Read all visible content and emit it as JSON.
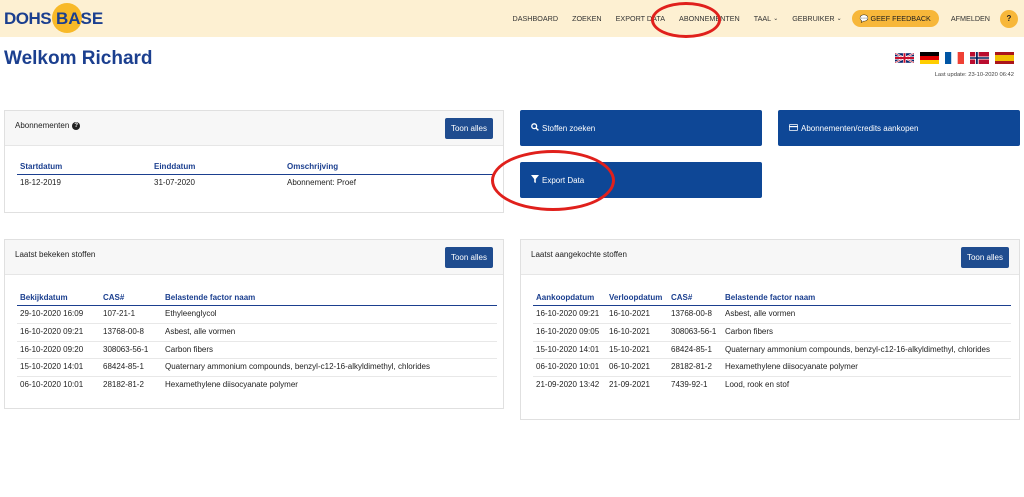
{
  "brand": {
    "part1": "DOHS",
    "part2": "BASE"
  },
  "nav": {
    "dashboard": "DASHBOARD",
    "zoeken": "ZOEKEN",
    "export": "EXPORT DATA",
    "abonnementen": "ABONNEMENTEN",
    "taal": "TAAL",
    "gebruiker": "GEBRUIKER",
    "feedback": "GEEF FEEDBACK",
    "afmelden": "AFMELDEN",
    "help": "?"
  },
  "welcome": "Welkom Richard",
  "last_update": "Last update: 23-10-2020 06:42",
  "subscriptions": {
    "title": "Abonnementen",
    "button": "Toon alles",
    "headers": [
      "Startdatum",
      "Einddatum",
      "Omschrijving"
    ],
    "rows": [
      [
        "18-12-2019",
        "31-07-2020",
        "Abonnement: Proef"
      ]
    ]
  },
  "actions": {
    "search": "Stoffen zoeken",
    "buy": "Abonnementen/credits aankopen",
    "export": "Export Data"
  },
  "viewed": {
    "title": "Laatst bekeken stoffen",
    "button": "Toon alles",
    "headers": [
      "Bekijkdatum",
      "CAS#",
      "Belastende factor naam"
    ],
    "rows": [
      [
        "29-10-2020 16:09",
        "107-21-1",
        "Ethyleenglycol"
      ],
      [
        "16-10-2020 09:21",
        "13768-00-8",
        "Asbest, alle vormen"
      ],
      [
        "16-10-2020 09:20",
        "308063-56-1",
        "Carbon fibers"
      ],
      [
        "15-10-2020 14:01",
        "68424-85-1",
        "Quaternary ammonium compounds, benzyl-c12-16-alkyldimethyl, chlorides"
      ],
      [
        "06-10-2020 10:01",
        "28182-81-2",
        "Hexamethylene diisocyanate polymer"
      ]
    ]
  },
  "bought": {
    "title": "Laatst aangekochte stoffen",
    "button": "Toon alles",
    "headers": [
      "Aankoopdatum",
      "Verloopdatum",
      "CAS#",
      "Belastende factor naam"
    ],
    "rows": [
      [
        "16-10-2020 09:21",
        "16-10-2021",
        "13768-00-8",
        "Asbest, alle vormen"
      ],
      [
        "16-10-2020 09:05",
        "16-10-2021",
        "308063-56-1",
        "Carbon fibers"
      ],
      [
        "15-10-2020 14:01",
        "15-10-2021",
        "68424-85-1",
        "Quaternary ammonium compounds, benzyl-c12-16-alkyldimethyl, chlorides"
      ],
      [
        "06-10-2020 10:01",
        "06-10-2021",
        "28182-81-2",
        "Hexamethylene diisocyanate polymer"
      ],
      [
        "21-09-2020 13:42",
        "21-09-2021",
        "7439-92-1",
        "Lood, rook en stof"
      ]
    ]
  },
  "colors": {
    "brand_blue": "#1b3f8f",
    "button_blue": "#0e4796",
    "nav_bg": "#fdf0d2",
    "accent": "#f7b73a",
    "annotation": "#e0201c"
  },
  "flags": [
    "uk-flag-icon",
    "germany-flag-icon",
    "france-flag-icon",
    "norway-flag-icon",
    "spain-flag-icon"
  ]
}
